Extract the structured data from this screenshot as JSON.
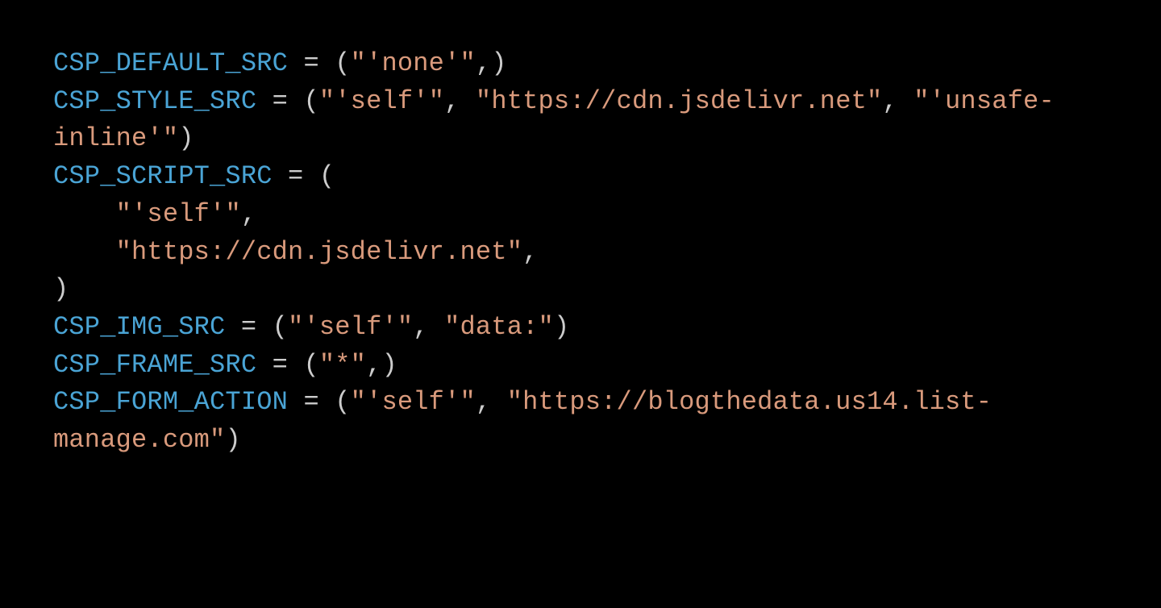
{
  "code": {
    "lines": [
      {
        "tokens": [
          {
            "cls": "tok-var",
            "text": "CSP_DEFAULT_SRC"
          },
          {
            "cls": "tok-op",
            "text": " = "
          },
          {
            "cls": "tok-punc",
            "text": "("
          },
          {
            "cls": "tok-str",
            "text": "\"'none'\""
          },
          {
            "cls": "tok-punc",
            "text": ",)"
          }
        ]
      },
      {
        "tokens": [
          {
            "cls": "tok-var",
            "text": "CSP_STYLE_SRC"
          },
          {
            "cls": "tok-op",
            "text": " = "
          },
          {
            "cls": "tok-punc",
            "text": "("
          },
          {
            "cls": "tok-str",
            "text": "\"'self'\""
          },
          {
            "cls": "tok-punc",
            "text": ", "
          },
          {
            "cls": "tok-str",
            "text": "\"https://cdn.jsdelivr.net\""
          },
          {
            "cls": "tok-punc",
            "text": ", "
          },
          {
            "cls": "tok-str",
            "text": "\"'unsafe-inline'\""
          },
          {
            "cls": "tok-punc",
            "text": ")"
          }
        ]
      },
      {
        "tokens": [
          {
            "cls": "tok-var",
            "text": "CSP_SCRIPT_SRC"
          },
          {
            "cls": "tok-op",
            "text": " = "
          },
          {
            "cls": "tok-punc",
            "text": "("
          }
        ]
      },
      {
        "tokens": [
          {
            "cls": "tok-punc",
            "text": "    "
          },
          {
            "cls": "tok-str",
            "text": "\"'self'\""
          },
          {
            "cls": "tok-punc",
            "text": ","
          }
        ]
      },
      {
        "tokens": [
          {
            "cls": "tok-punc",
            "text": "    "
          },
          {
            "cls": "tok-str",
            "text": "\"https://cdn.jsdelivr.net\""
          },
          {
            "cls": "tok-punc",
            "text": ","
          }
        ]
      },
      {
        "tokens": [
          {
            "cls": "tok-punc",
            "text": ")"
          }
        ]
      },
      {
        "tokens": [
          {
            "cls": "tok-var",
            "text": "CSP_IMG_SRC"
          },
          {
            "cls": "tok-op",
            "text": " = "
          },
          {
            "cls": "tok-punc",
            "text": "("
          },
          {
            "cls": "tok-str",
            "text": "\"'self'\""
          },
          {
            "cls": "tok-punc",
            "text": ", "
          },
          {
            "cls": "tok-str",
            "text": "\"data:\""
          },
          {
            "cls": "tok-punc",
            "text": ")"
          }
        ]
      },
      {
        "tokens": [
          {
            "cls": "tok-var",
            "text": "CSP_FRAME_SRC"
          },
          {
            "cls": "tok-op",
            "text": " = "
          },
          {
            "cls": "tok-punc",
            "text": "("
          },
          {
            "cls": "tok-str",
            "text": "\"*\""
          },
          {
            "cls": "tok-punc",
            "text": ",)"
          }
        ]
      },
      {
        "tokens": [
          {
            "cls": "tok-var",
            "text": "CSP_FORM_ACTION"
          },
          {
            "cls": "tok-op",
            "text": " = "
          },
          {
            "cls": "tok-punc",
            "text": "("
          },
          {
            "cls": "tok-str",
            "text": "\"'self'\""
          },
          {
            "cls": "tok-punc",
            "text": ", "
          },
          {
            "cls": "tok-str",
            "text": "\"https://blogthedata.us14.list-manage.com\""
          },
          {
            "cls": "tok-punc",
            "text": ")"
          }
        ]
      }
    ]
  }
}
